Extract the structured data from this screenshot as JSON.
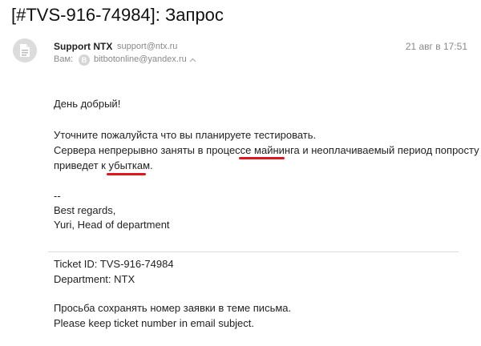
{
  "email": {
    "subject": "[#TVS-916-74984]: Запрос",
    "sender_name": "Support NTX",
    "sender_email": "support@ntx.ru",
    "date": "21 авг в 17:51",
    "to_label": "Вам:",
    "to_avatar_letter": "B",
    "to_email": "bitbotonline@yandex.ru",
    "body": {
      "greeting": "День добрый!",
      "line1": "Уточните пожалуйста что вы планируете тестировать.",
      "line2": "Сервера непрерывно заняты в процессе майнинга и неоплачиваемый период попросту",
      "line3": "приведет к убыткам.",
      "sig_dash": "--",
      "sig_regards": "Best regards,",
      "sig_name": "Yuri, Head of department",
      "ticket_id": "Ticket ID: TVS-916-74984",
      "department": "Department: NTX",
      "note_ru": "Просьба сохранять номер заявки в теме письма.",
      "note_en": "Please keep ticket number in email subject."
    }
  },
  "icons": {
    "avatar": "document-icon",
    "to_toggle": "chevron-up-icon"
  },
  "colors": {
    "underline": "#e0161c"
  }
}
